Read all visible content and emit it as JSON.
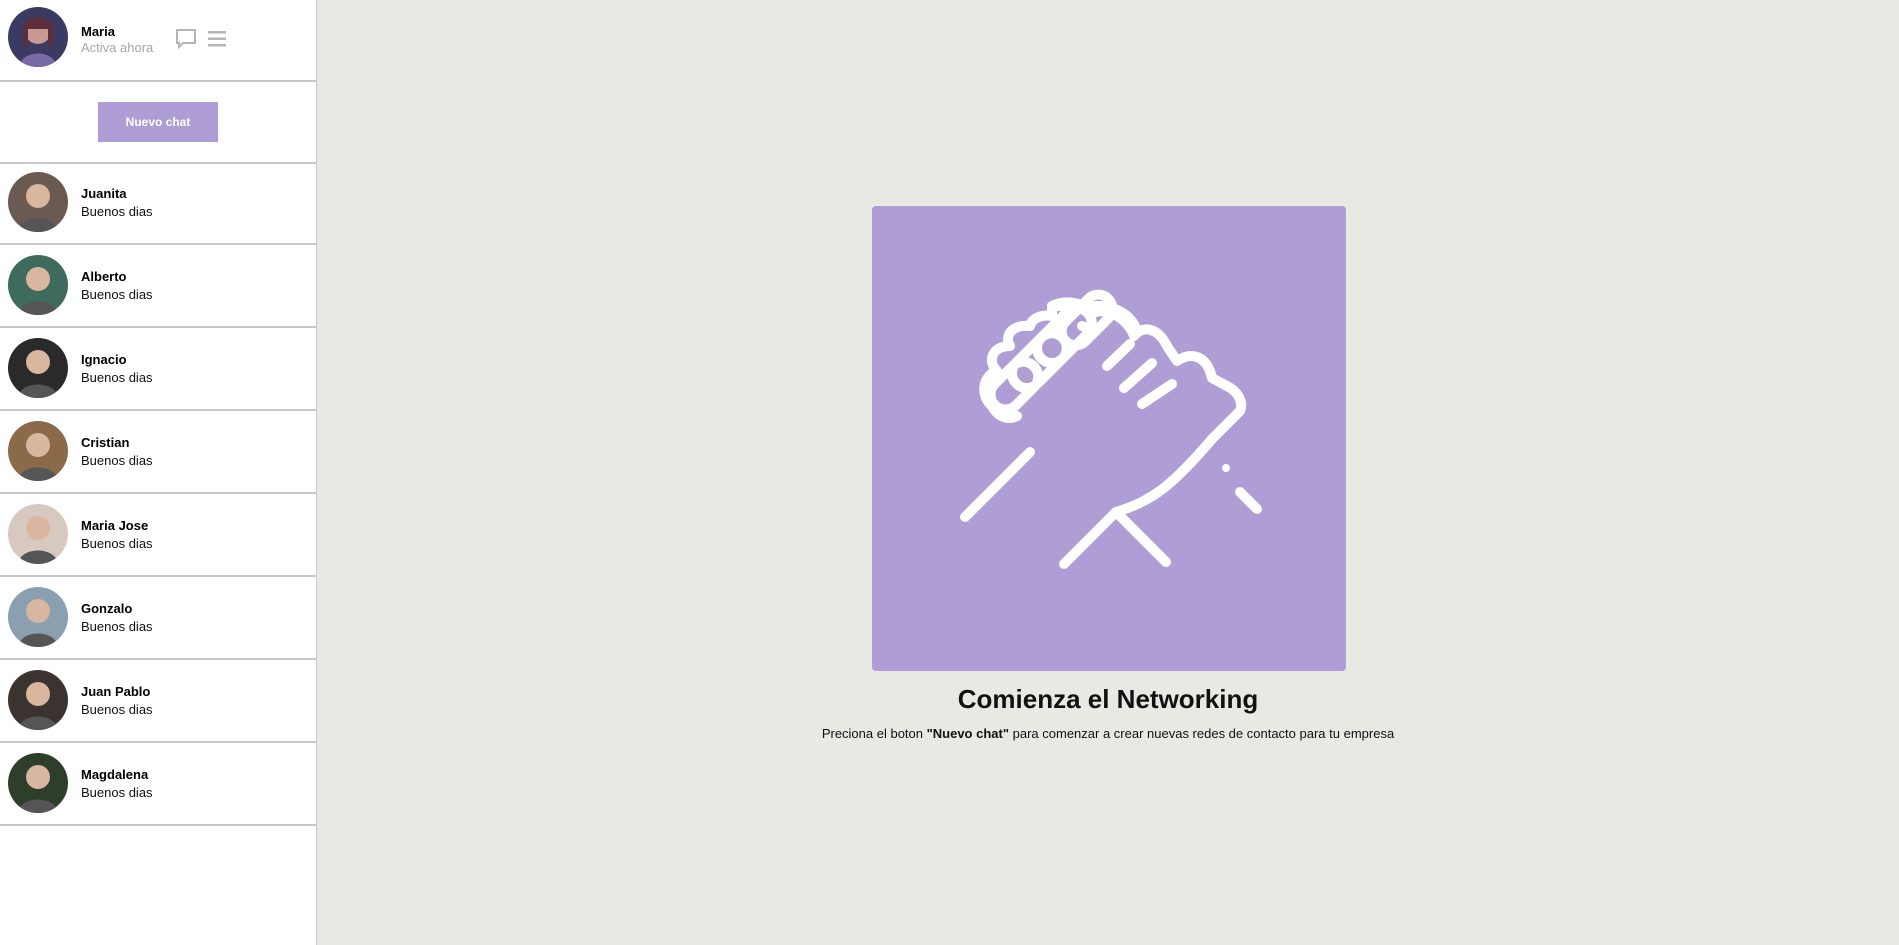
{
  "profile": {
    "name": "Maria",
    "status": "Activa ahora",
    "icons": [
      "chat-bubble-icon",
      "menu-icon"
    ]
  },
  "new_chat_button": "Nuevo chat",
  "chats": [
    {
      "name": "Juanita",
      "message": "Buenos dias",
      "avatar_color": "#6b5a52"
    },
    {
      "name": "Alberto",
      "message": "Buenos dias",
      "avatar_color": "#3e6b5e"
    },
    {
      "name": "Ignacio",
      "message": "Buenos dias",
      "avatar_color": "#2a2a2a"
    },
    {
      "name": "Cristian",
      "message": "Buenos dias",
      "avatar_color": "#8a6a48"
    },
    {
      "name": "Maria Jose",
      "message": "Buenos dias",
      "avatar_color": "#d8c9c0"
    },
    {
      "name": "Gonzalo",
      "message": "Buenos dias",
      "avatar_color": "#8aa0b0"
    },
    {
      "name": "Juan Pablo",
      "message": "Buenos dias",
      "avatar_color": "#3a3330"
    },
    {
      "name": "Magdalena",
      "message": "Buenos dias",
      "avatar_color": "#2f3e2a"
    }
  ],
  "main": {
    "title": "Comienza el Networking",
    "subtitle_prefix": "Preciona el boton ",
    "subtitle_highlight": "\"Nuevo chat\"",
    "subtitle_suffix": " para comenzar a crear nuevas redes de contacto para tu empresa",
    "hero_icon": "handshake-icon"
  },
  "colors": {
    "accent": "#af9dd6",
    "background": "#e7e9e2",
    "sidebar": "#ffffff",
    "divider": "#c9c9c9"
  }
}
